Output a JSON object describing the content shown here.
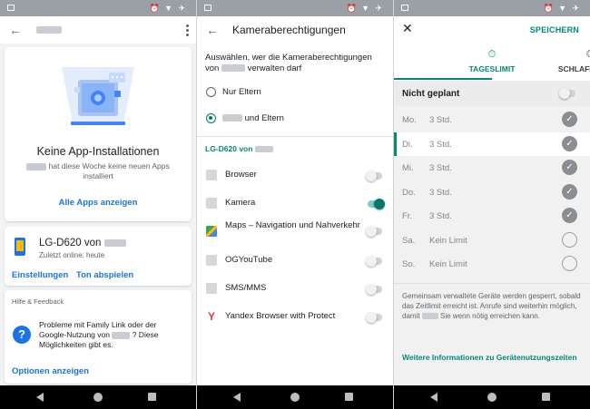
{
  "overview": {
    "no_installs_title": "Keine App-Installationen",
    "no_installs_desc": "hat diese Woche keine neuen Apps installiert",
    "all_apps_link": "Alle Apps anzeigen",
    "device_name": "LG-D620 von",
    "last_online": "Zuletzt online: heute",
    "settings_link": "Einstellungen",
    "sound_link": "Ton abspielen",
    "help_header": "Hilfe & Feedback",
    "help_text_a": "Probleme mit Family Link oder der Google-Nutzung von",
    "help_text_b": "? Diese Möglichkeiten gibt es.",
    "help_link": "Optionen anzeigen"
  },
  "permissions": {
    "title": "Kameraberechtigungen",
    "subtitle_a": "Auswählen, wer die Kameraberechtigungen von",
    "subtitle_b": "verwalten darf",
    "option_parents_only": "Nur Eltern",
    "option_child_and_parents": "und Eltern",
    "section_title": "LG-D620 von",
    "apps": [
      {
        "name": "Browser",
        "enabled": false
      },
      {
        "name": "Kamera",
        "enabled": true
      },
      {
        "name": "Maps – Navigation und Nahverkehr",
        "enabled": false
      },
      {
        "name": "OGYouTube",
        "enabled": false
      },
      {
        "name": "SMS/MMS",
        "enabled": false
      },
      {
        "name": "Yandex Browser with Protect",
        "enabled": false
      }
    ],
    "yandex_glyph": "Y"
  },
  "limits": {
    "save_label": "SPEICHERN",
    "tab_daily": "TAGESLIMIT",
    "tab_bedtime": "SCHLAFENSZEIT",
    "schedule_label": "Nicht geplant",
    "days": [
      {
        "day": "Mo.",
        "limit": "3 Std.",
        "checked": true
      },
      {
        "day": "Di.",
        "limit": "3 Std.",
        "checked": true
      },
      {
        "day": "Mi.",
        "limit": "3 Std.",
        "checked": true
      },
      {
        "day": "Do.",
        "limit": "3 Std.",
        "checked": true
      },
      {
        "day": "Fr.",
        "limit": "3 Std.",
        "checked": true
      },
      {
        "day": "Sa.",
        "limit": "Kein Limit",
        "checked": false
      },
      {
        "day": "So.",
        "limit": "Kein Limit",
        "checked": false
      }
    ],
    "info_text_a": "Gemeinsam verwaltete Geräte werden gesperrt, sobald das Zeitlimit erreicht ist. Anrufe sind weiterhin möglich, damit",
    "info_text_b": "Sie wenn nötig erreichen kann.",
    "info_link": "Weitere Informationen zu Gerätenutzungszeiten"
  },
  "colors": {
    "accent_teal": "#00897b",
    "link_blue": "#1a73e8"
  },
  "icons": {
    "checkmark": "✓",
    "close": "✕",
    "back_arrow": "←",
    "timer": "⏱",
    "moon": "☾",
    "help": "?"
  }
}
